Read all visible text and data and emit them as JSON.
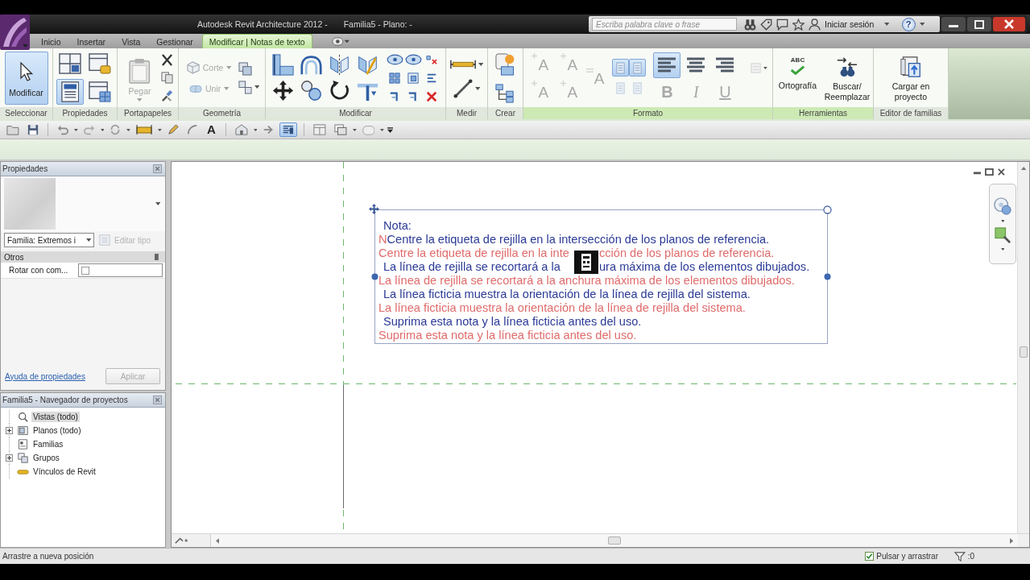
{
  "title_bar": {
    "app_name": "Autodesk Revit Architecture 2012 -",
    "document": "Familia5 - Plano: -",
    "search": {
      "placeholder": "Escriba palabra clave o frase"
    },
    "sign_in": "Iniciar sesión",
    "help": "?"
  },
  "tabs": [
    {
      "label": "Inicio",
      "selected": false
    },
    {
      "label": "Insertar",
      "selected": false
    },
    {
      "label": "Vista",
      "selected": false
    },
    {
      "label": "Gestionar",
      "selected": false
    },
    {
      "label": "Modificar | Notas de texto",
      "selected": true
    }
  ],
  "ribbon": {
    "panels": [
      {
        "label": "Seleccionar",
        "contextual": false,
        "buttons": [
          {
            "label": "Modificar",
            "selected": true
          }
        ]
      },
      {
        "label": "Propiedades",
        "contextual": false,
        "buttons": [
          {
            "selected": false
          },
          {
            "selected": false
          },
          {
            "selected": true
          },
          {
            "selected": false
          }
        ]
      },
      {
        "label": "Portapapeles",
        "contextual": false,
        "buttons": [
          {
            "label": "Pegar",
            "disabled": true
          }
        ]
      },
      {
        "label": "Geometría",
        "contextual": false,
        "buttons": [
          {
            "label": "Corte",
            "disabled": true
          },
          {
            "label": "Unir",
            "disabled": true
          }
        ]
      },
      {
        "label": "Modificar",
        "contextual": false
      },
      {
        "label": "Medir",
        "contextual": false
      },
      {
        "label": "Crear",
        "contextual": false
      },
      {
        "label": "Formato",
        "contextual": true,
        "font_buttons": [
          {
            "label": "A",
            "disabled": true
          },
          {
            "label": "A",
            "disabled": true
          },
          {
            "label": "A",
            "disabled": true
          },
          {
            "label": "A",
            "disabled": true
          }
        ],
        "size_button": {
          "label": "A",
          "disabled": true
        },
        "list_buttons": [
          {
            "selected": true,
            "disabled": false
          },
          {
            "selected": true,
            "disabled": false
          },
          {
            "selected": false,
            "disabled": true
          },
          {
            "selected": false,
            "disabled": true
          }
        ],
        "align_buttons": [
          {
            "selected": true
          },
          {
            "selected": false
          },
          {
            "selected": false
          }
        ],
        "style_buttons": [
          {
            "label": "B",
            "disabled": true
          },
          {
            "label": "I",
            "disabled": true
          },
          {
            "label": "U",
            "disabled": true
          }
        ]
      },
      {
        "label": "Herramientas",
        "contextual": true,
        "buttons": [
          {
            "label": "Ortografía",
            "icon_text": "ABC"
          },
          {
            "label": "Buscar/ Reemplazar"
          }
        ]
      },
      {
        "label": "Editor de familias",
        "contextual": false,
        "buttons": [
          {
            "label": "Cargar en proyecto"
          }
        ]
      }
    ]
  },
  "quick_access": [
    {
      "selected": false
    },
    {
      "selected": false
    },
    {
      "selected": false
    },
    {
      "selected": false
    },
    {
      "selected": false
    },
    {
      "selected": false
    },
    {
      "selected": false
    },
    {
      "selected": false
    },
    {
      "label": "A",
      "selected": false
    },
    {
      "selected": false
    },
    {
      "selected": false
    },
    {
      "selected": true
    },
    {
      "selected": false
    },
    {
      "selected": false
    },
    {
      "selected": false
    }
  ],
  "properties": {
    "title": "Propiedades",
    "type_selector": "Familia: Extremos i",
    "edit_type": {
      "label": "Editar tipo",
      "disabled": true
    },
    "groups": [
      {
        "label": "Otros",
        "rows": [
          {
            "name": "Rotar con com...",
            "checked": false
          }
        ]
      }
    ],
    "help_link": "Ayuda de propiedades",
    "apply": {
      "label": "Aplicar",
      "disabled": true
    }
  },
  "project_browser": {
    "title": "Familia5 - Navegador de proyectos",
    "items": [
      {
        "label": "Vistas (todo)",
        "selected": true,
        "expandable": false
      },
      {
        "label": "Planos (todo)",
        "selected": false,
        "expandable": true
      },
      {
        "label": "Familias",
        "selected": false,
        "expandable": false
      },
      {
        "label": "Grupos",
        "selected": false,
        "expandable": true
      },
      {
        "label": "Vínculos de Revit",
        "selected": false,
        "expandable": false
      }
    ]
  },
  "canvas": {
    "note": {
      "preview_lines": [
        {
          "text": "Nota:"
        },
        {
          "text": "Centre la etiqueta de rejilla en la intersección de los planos de referencia."
        },
        {
          "text": "La línea de rejilla se recortará a la",
          "text_after_cursor": "ura máxima de los elementos dibujados."
        },
        {
          "text": "La línea ficticia muestra la orientación de la línea de rejilla del sistema."
        },
        {
          "text": "Suprima esta nota y la línea ficticia antes del uso."
        }
      ],
      "original_lines": [
        {
          "text": "N"
        },
        {
          "text": "Centre la etiqueta de rejilla en la inte",
          "text_after_cursor": "cción de los planos de referencia."
        },
        {
          "text": "La línea de rejilla se recortará a la anchura máxima de los elementos dibujados."
        },
        {
          "text": "La línea ficticia muestra la orientación de la línea de rejilla del sistema."
        },
        {
          "text": "Suprima esta nota y la línea ficticia antes del uso."
        }
      ]
    }
  },
  "status_bar": {
    "message": "Arrastre a nueva posición",
    "drag_option": {
      "label": "Pulsar y arrastrar",
      "checked": true
    },
    "filter_count": ":0"
  }
}
